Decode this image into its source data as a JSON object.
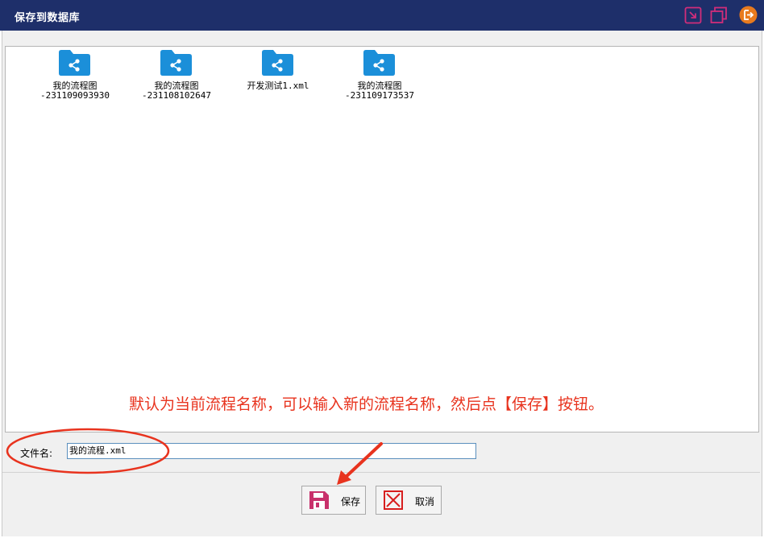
{
  "window": {
    "title": "保存到数据库"
  },
  "files": [
    {
      "name": "我的流程图\n-231109093930"
    },
    {
      "name": "我的流程图\n-231108102647"
    },
    {
      "name": "开发测试1.xml"
    },
    {
      "name": "我的流程图\n-231109173537"
    }
  ],
  "hint_text": "默认为当前流程名称，可以输入新的流程名称，然后点【保存】按钮。",
  "filename": {
    "label": "文件名:",
    "value": "我的流程.xml"
  },
  "buttons": {
    "save": "保存",
    "cancel": "取消"
  },
  "colors": {
    "titlebar": "#1e2f6a",
    "folder": "#1b8fd9",
    "annotation": "#e8331e",
    "save_icon": "#c8316b",
    "cancel_icon": "#d81e1e",
    "close_icon": "#e87a1e"
  }
}
